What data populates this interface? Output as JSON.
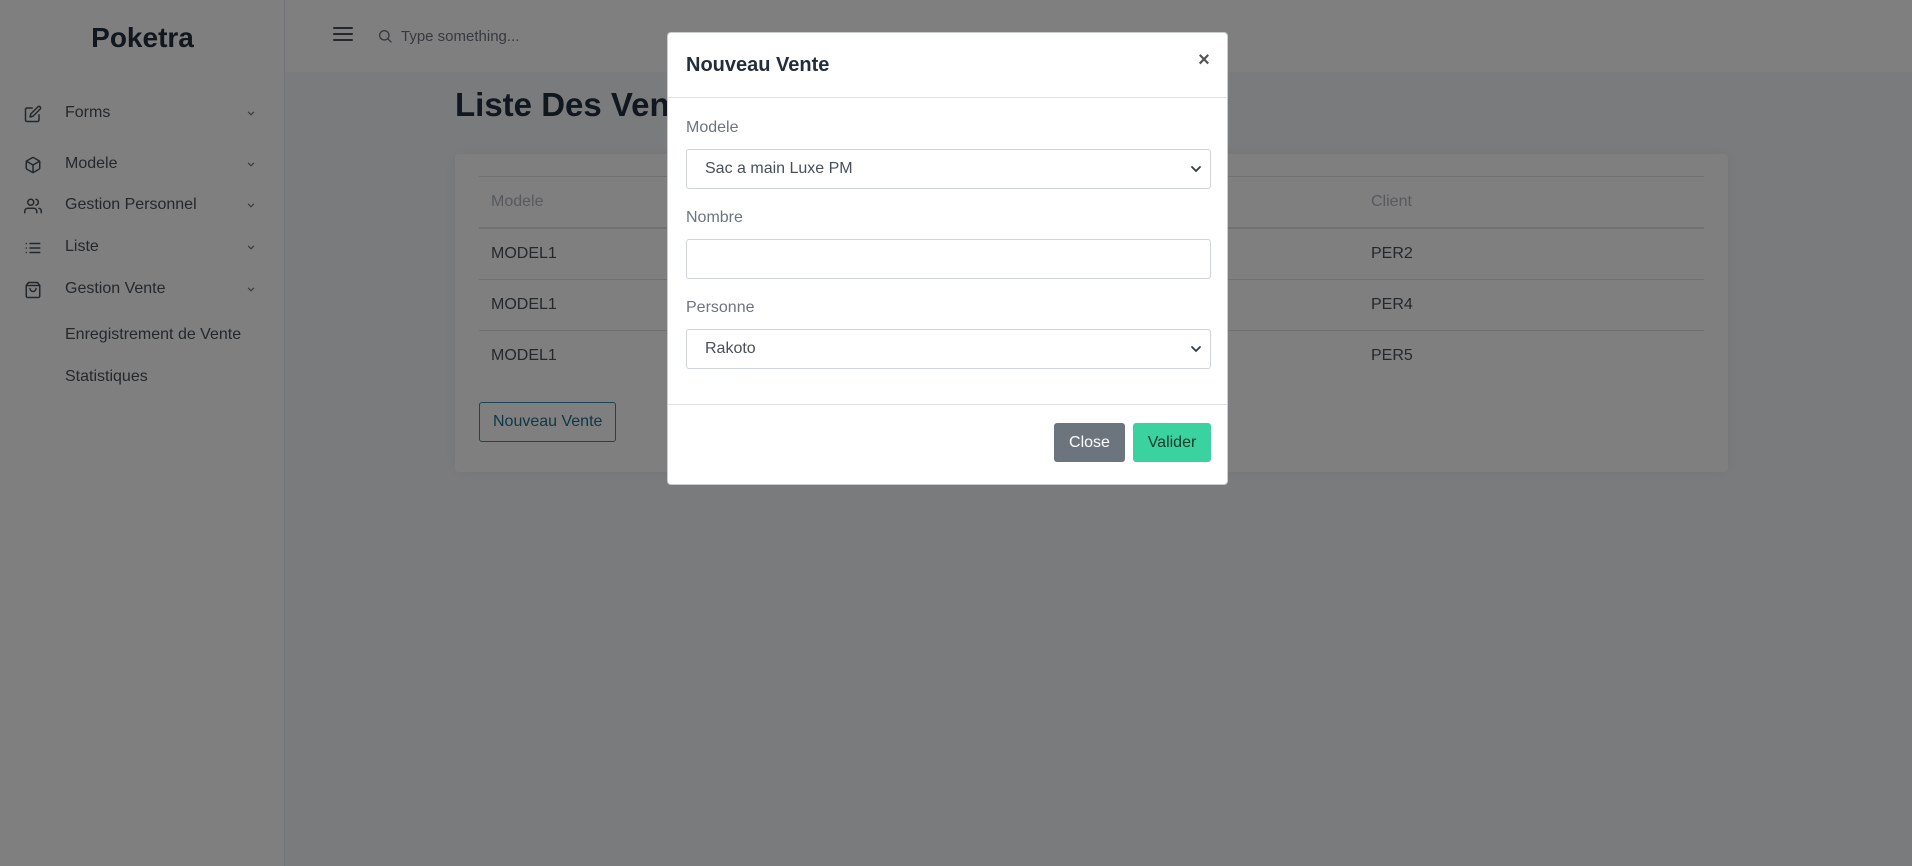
{
  "brand": "Poketra",
  "sidebar": {
    "items": [
      {
        "label": "Forms",
        "icon": "edit-icon"
      },
      {
        "label": "Modele",
        "icon": "box-icon"
      },
      {
        "label": "Gestion Personnel",
        "icon": "users-icon"
      },
      {
        "label": "Liste",
        "icon": "list-icon"
      },
      {
        "label": "Gestion Vente",
        "icon": "shopping-bag-icon"
      }
    ],
    "subitems": [
      {
        "label": "Enregistrement de Vente"
      },
      {
        "label": "Statistiques"
      }
    ]
  },
  "topbar": {
    "search_placeholder": "Type something..."
  },
  "main": {
    "title": "Liste Des Ventes",
    "table": {
      "headers": [
        "Modele",
        "Client"
      ],
      "rows": [
        [
          "MODEL1",
          "PER2"
        ],
        [
          "MODEL1",
          "PER4"
        ],
        [
          "MODEL1",
          "PER5"
        ]
      ]
    },
    "new_button": "Nouveau Vente"
  },
  "modal": {
    "title": "Nouveau Vente",
    "close_symbol": "×",
    "fields": {
      "modele_label": "Modele",
      "modele_value": "Sac a main Luxe PM",
      "nombre_label": "Nombre",
      "nombre_value": "",
      "personne_label": "Personne",
      "personne_value": "Rakoto"
    },
    "close_button": "Close",
    "submit_button": "Valider"
  },
  "colors": {
    "brand_text": "#222e3c",
    "valider": "#3ad29f",
    "close": "#6c757d"
  }
}
